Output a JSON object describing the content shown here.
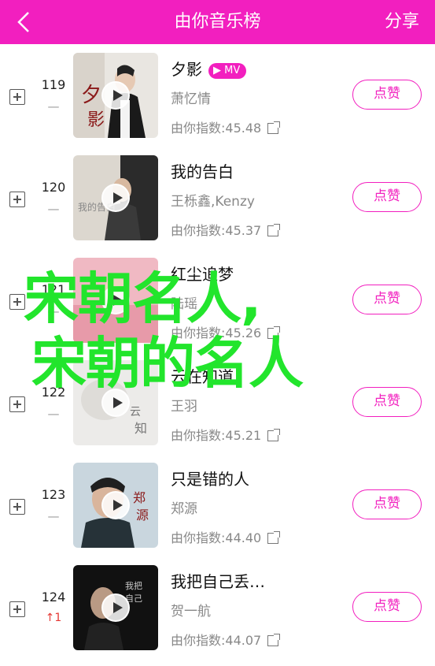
{
  "header": {
    "back_icon": "chevron-left-icon",
    "title": "由你音乐榜",
    "share_label": "分享"
  },
  "songs": [
    {
      "rank": "119",
      "change": "—",
      "change_up": false,
      "title": "夕影",
      "has_mv": true,
      "mv_label": "MV",
      "artist": "萧忆情",
      "index": "由你指数:45.48",
      "like": "点赞",
      "cover_text": "夕影"
    },
    {
      "rank": "120",
      "change": "—",
      "change_up": false,
      "title": "我的告白",
      "has_mv": false,
      "mv_label": "",
      "artist": "王栎鑫,Kenzy",
      "index": "由你指数:45.37",
      "like": "点赞",
      "cover_text": "我的告白"
    },
    {
      "rank": "121",
      "change": "—",
      "change_up": false,
      "title": "红尘追梦",
      "has_mv": false,
      "mv_label": "",
      "artist": "陆瑶",
      "index": "由你指数:45.26",
      "like": "点赞",
      "cover_text": ""
    },
    {
      "rank": "122",
      "change": "—",
      "change_up": false,
      "title": "云在知道",
      "has_mv": false,
      "mv_label": "",
      "artist": "王羽",
      "index": "由你指数:45.21",
      "like": "点赞",
      "cover_text": "云知"
    },
    {
      "rank": "123",
      "change": "—",
      "change_up": false,
      "title": "只是错的人",
      "has_mv": false,
      "mv_label": "",
      "artist": "郑源",
      "index": "由你指数:44.40",
      "like": "点赞",
      "cover_text": "郑源"
    },
    {
      "rank": "124",
      "change": "↑1",
      "change_up": true,
      "title": "我把自己丢…",
      "has_mv": false,
      "mv_label": "",
      "artist": "贺一航",
      "index": "由你指数:44.07",
      "like": "点赞",
      "cover_text": "我把自己丢在哪"
    }
  ],
  "overlay": {
    "line1": "宋朝名人,",
    "line2": "宋朝的名人",
    "color": "#22e52c"
  },
  "colors": {
    "accent": "#f21fbf"
  }
}
